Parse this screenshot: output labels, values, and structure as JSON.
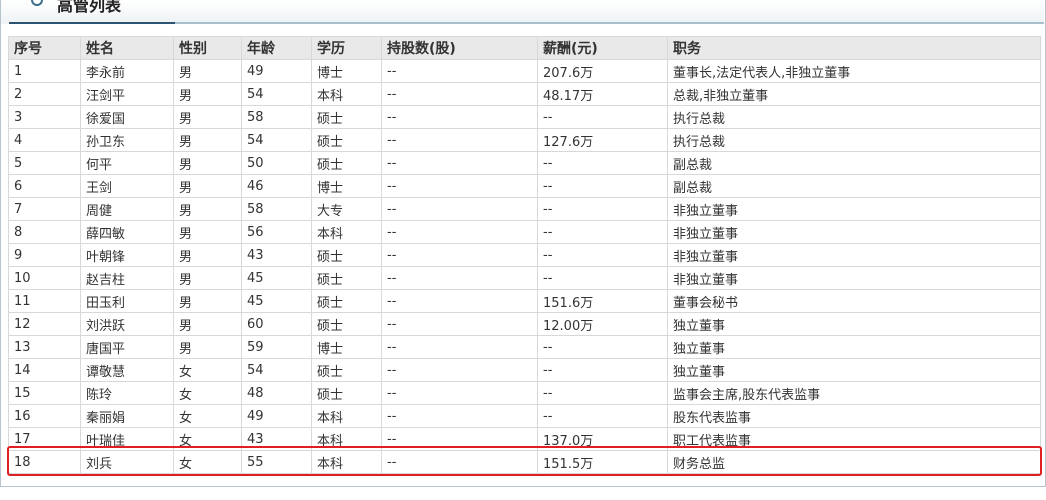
{
  "title": "高管列表",
  "headers": [
    "序号",
    "姓名",
    "性别",
    "年龄",
    "学历",
    "持股数(股)",
    "薪酬(元)",
    "职务"
  ],
  "rows": [
    [
      "1",
      "李永前",
      "男",
      "49",
      "博士",
      "--",
      "207.6万",
      "董事长,法定代表人,非独立董事"
    ],
    [
      "2",
      "汪剑平",
      "男",
      "54",
      "本科",
      "--",
      "48.17万",
      "总裁,非独立董事"
    ],
    [
      "3",
      "徐爱国",
      "男",
      "58",
      "硕士",
      "--",
      "--",
      "执行总裁"
    ],
    [
      "4",
      "孙卫东",
      "男",
      "54",
      "硕士",
      "--",
      "127.6万",
      "执行总裁"
    ],
    [
      "5",
      "何平",
      "男",
      "50",
      "硕士",
      "--",
      "--",
      "副总裁"
    ],
    [
      "6",
      "王剑",
      "男",
      "46",
      "博士",
      "--",
      "--",
      "副总裁"
    ],
    [
      "7",
      "周健",
      "男",
      "58",
      "大专",
      "--",
      "--",
      "非独立董事"
    ],
    [
      "8",
      "薛四敏",
      "男",
      "56",
      "本科",
      "--",
      "--",
      "非独立董事"
    ],
    [
      "9",
      "叶朝锋",
      "男",
      "43",
      "硕士",
      "--",
      "--",
      "非独立董事"
    ],
    [
      "10",
      "赵吉柱",
      "男",
      "45",
      "硕士",
      "--",
      "--",
      "非独立董事"
    ],
    [
      "11",
      "田玉利",
      "男",
      "45",
      "硕士",
      "--",
      "151.6万",
      "董事会秘书"
    ],
    [
      "12",
      "刘洪跃",
      "男",
      "60",
      "硕士",
      "--",
      "12.00万",
      "独立董事"
    ],
    [
      "13",
      "唐国平",
      "男",
      "59",
      "博士",
      "--",
      "--",
      "独立董事"
    ],
    [
      "14",
      "谭敬慧",
      "女",
      "54",
      "硕士",
      "--",
      "--",
      "独立董事"
    ],
    [
      "15",
      "陈玲",
      "女",
      "48",
      "硕士",
      "--",
      "--",
      "监事会主席,股东代表监事"
    ],
    [
      "16",
      "秦丽娟",
      "女",
      "49",
      "本科",
      "--",
      "--",
      "股东代表监事"
    ],
    [
      "17",
      "叶瑞佳",
      "女",
      "43",
      "本科",
      "--",
      "137.0万",
      "职工代表监事"
    ],
    [
      "18",
      "刘兵",
      "女",
      "55",
      "本科",
      "--",
      "151.5万",
      "财务总监"
    ]
  ],
  "highlight_color": "#e02020"
}
